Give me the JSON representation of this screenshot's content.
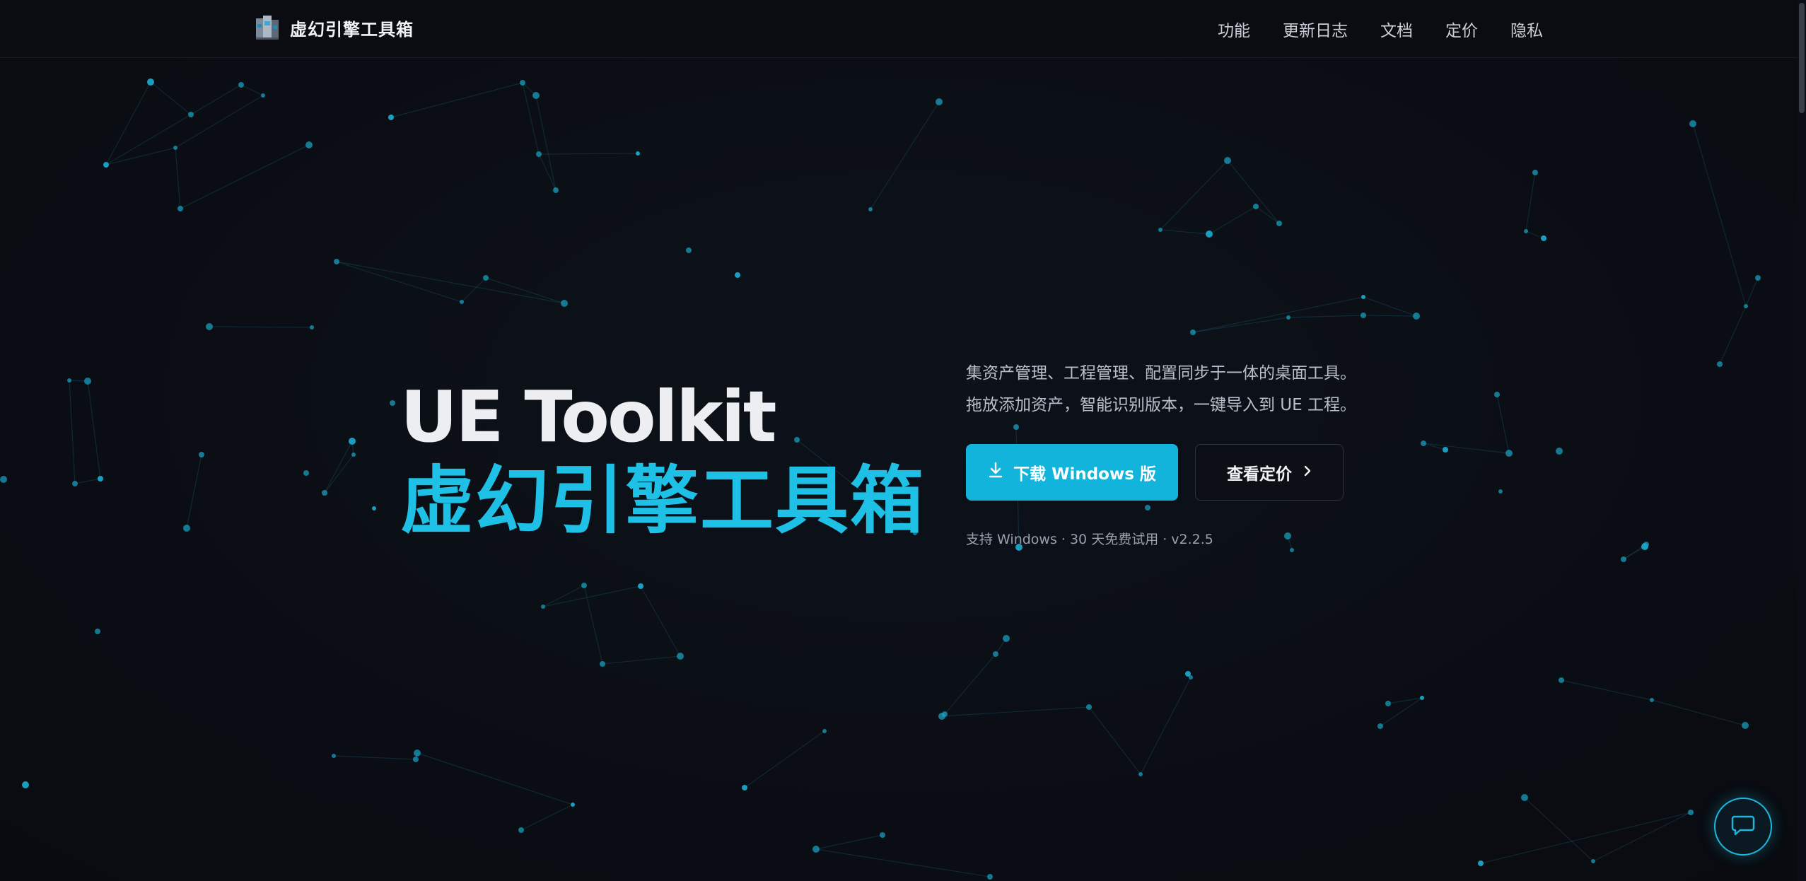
{
  "header": {
    "brand_name": "虚幻引擎工具箱",
    "logo_icon": "cube-tower-icon",
    "nav": [
      "功能",
      "更新日志",
      "文档",
      "定价",
      "隐私"
    ]
  },
  "hero": {
    "title_en": "UE Toolkit",
    "title_cn": "虚幻引擎工具箱",
    "description_line1": "集资产管理、工程管理、配置同步于一体的桌面工具。",
    "description_line2": "拖放添加资产，智能识别版本，一键导入到 UE 工程。",
    "primary_button": "下载 Windows 版",
    "primary_icon": "download-icon",
    "secondary_button": "查看定价",
    "secondary_icon": "chevron-right-icon",
    "meta": "支持 Windows · 30 天免费试用 · v2.2.5"
  },
  "chat": {
    "icon": "chat-bubble-icon"
  },
  "colors": {
    "accent": "#12b4dc",
    "title_cn": "#1fc0e5",
    "background": "#0b0e14"
  }
}
